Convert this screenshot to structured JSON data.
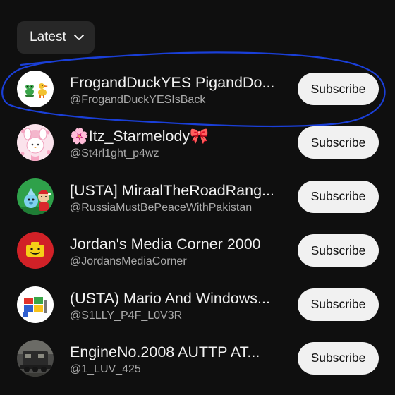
{
  "sort": {
    "label": "Latest",
    "icon": "chevron-down-icon"
  },
  "subscribe_label": "Subscribe",
  "channels": [
    {
      "name": "FrogandDuckYES PigandDo...",
      "handle": "@FrogandDuckYESIsBack",
      "avatar": "frog-duck-avatar"
    },
    {
      "name": "🌸Itz_Starmelody🎀",
      "handle": "@St4rl1ght_p4wz",
      "avatar": "pink-character-avatar"
    },
    {
      "name": "[USTA] MiraalTheRoadRang...",
      "handle": "@RussiaMustBePeaceWithPakistan",
      "avatar": "cartoon-character-avatar"
    },
    {
      "name": "Jordan's Media Corner 2000",
      "handle": "@JordansMediaCorner",
      "avatar": "yellow-block-face-avatar"
    },
    {
      "name": "(USTA) Mario And Windows...",
      "handle": "@S1LLY_P4F_L0V3R",
      "avatar": "windows-logo-avatar"
    },
    {
      "name": "EngineNo.2008 AUTTP AT...",
      "handle": "@1_LUV_425",
      "avatar": "locomotive-photo-avatar"
    }
  ],
  "colors": {
    "background": "#0f0f0f",
    "chip": "#272727",
    "subscribe_bg": "#f1f1f1",
    "handle_text": "#aaaaaa",
    "annotation_ink": "#1a3fd8"
  }
}
